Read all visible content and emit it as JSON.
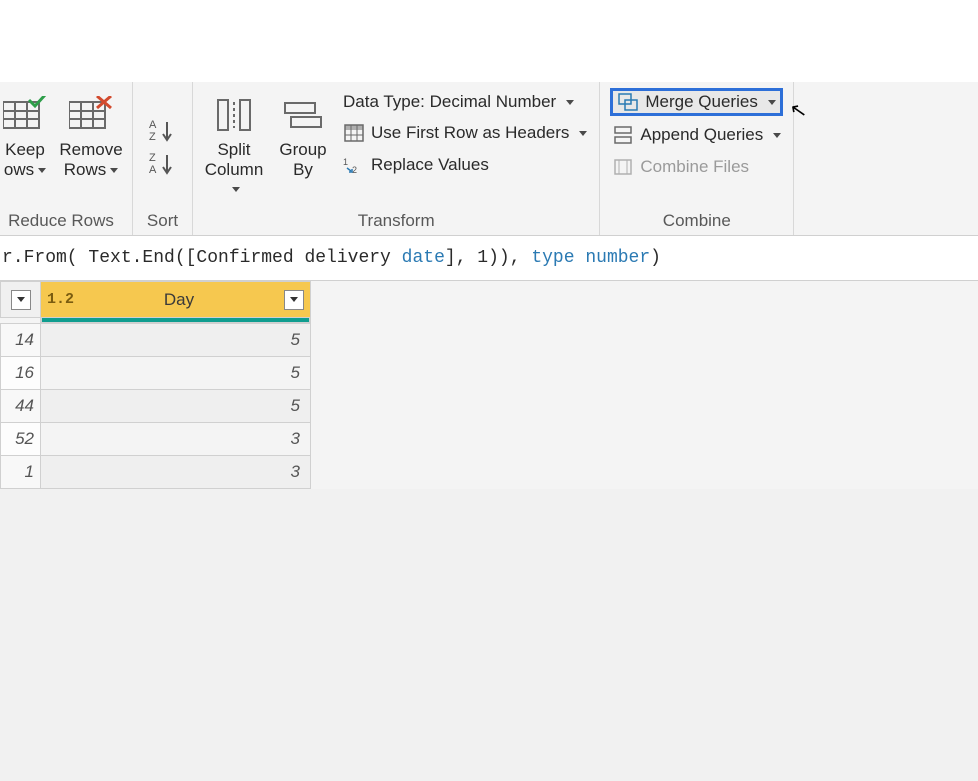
{
  "ribbon": {
    "reduce_rows": {
      "keep": "Keep\nows",
      "remove": "Remove\nRows",
      "label": "Reduce Rows"
    },
    "sort": {
      "label": "Sort"
    },
    "transform": {
      "split": "Split\nColumn",
      "group": "Group\nBy",
      "datatype": "Data Type: Decimal Number",
      "first_row": "Use First Row as Headers",
      "replace": "Replace Values",
      "label": "Transform"
    },
    "combine": {
      "merge": "Merge Queries",
      "append": "Append Queries",
      "combine_files": "Combine Files",
      "label": "Combine"
    }
  },
  "formula": {
    "pre": "r.From( Text.End([Confirmed delivery ",
    "field": "date",
    "mid": "], 1)), ",
    "kw1": "type",
    "sp": " ",
    "kw2": "number",
    "post": ")"
  },
  "column": {
    "type_badge": "1.2",
    "name": "Day"
  },
  "rows": [
    {
      "idx": "14",
      "val": "5"
    },
    {
      "idx": "16",
      "val": "5"
    },
    {
      "idx": "44",
      "val": "5"
    },
    {
      "idx": "52",
      "val": "3"
    },
    {
      "idx": "1",
      "val": "3"
    }
  ]
}
